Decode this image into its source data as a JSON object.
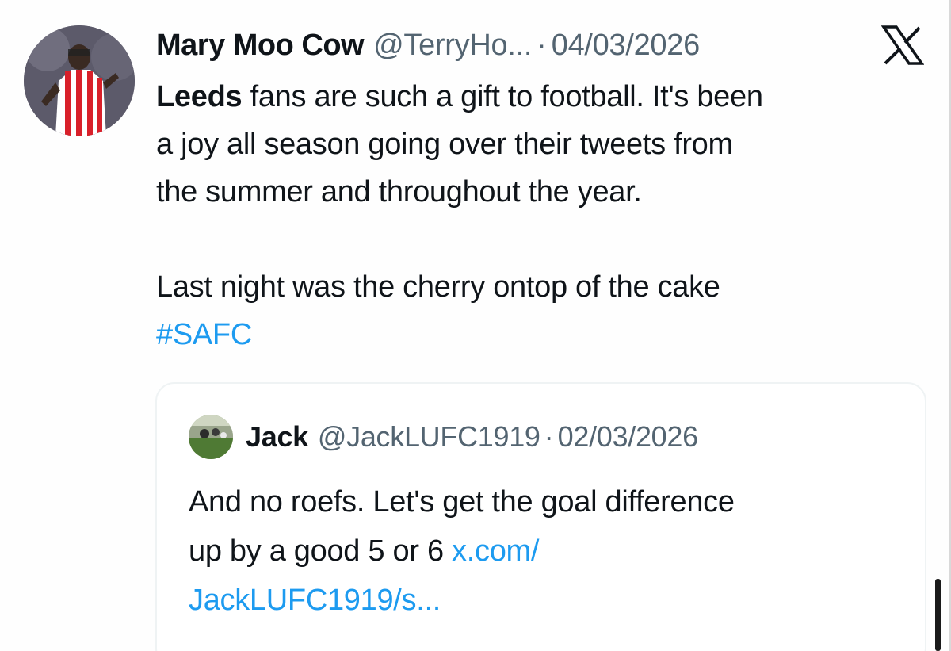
{
  "tweet": {
    "display_name": "Mary Moo Cow",
    "handle": "@TerryHo...",
    "separator": "·",
    "date": "04/03/2026",
    "text_lines": {
      "l1_bold": "Leeds",
      "l1_rest": " fans are such a gift to football. It's been",
      "l2": "a joy all season going over their tweets from",
      "l3": "the summer and throughout the year.",
      "l4": "Last night was the cherry ontop of the cake"
    },
    "hashtag": "#SAFC",
    "platform_icon": "x-logo-icon"
  },
  "quoted_tweet": {
    "display_name": "Jack",
    "handle": "@JackLUFC1919",
    "separator": "·",
    "date": "02/03/2026",
    "text_lines": {
      "l1": "And no roefs. Let's get the goal difference",
      "l2_text": "up by a good 5 or 6 ",
      "l2_link": "x.com/",
      "l3_link": "JackLUFC1919/s..."
    }
  },
  "colors": {
    "primary_text": "#0f1419",
    "secondary_text": "#536471",
    "link": "#1d9bf0",
    "border": "#eff3f4"
  }
}
